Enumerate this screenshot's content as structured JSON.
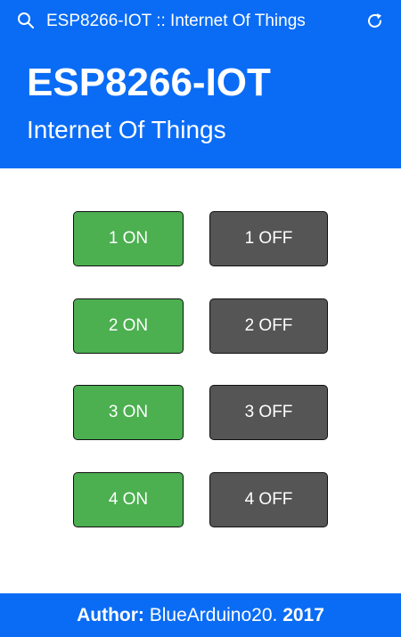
{
  "topbar": {
    "title": "ESP8266-IOT :: Internet Of Things",
    "icons": [
      "search-icon",
      "reload-icon"
    ]
  },
  "hero": {
    "title": "ESP8266-IOT",
    "subtitle": "Internet Of Things"
  },
  "controls": [
    {
      "on_label": "1 ON",
      "off_label": "1 OFF"
    },
    {
      "on_label": "2 ON",
      "off_label": "2 OFF"
    },
    {
      "on_label": "3 ON",
      "off_label": "3 OFF"
    },
    {
      "on_label": "4 ON",
      "off_label": "4 OFF"
    }
  ],
  "footer": {
    "author_label": "Author:",
    "author_name": " BlueArduino20. ",
    "year": "2017"
  },
  "colors": {
    "accent": "#0a6cf5",
    "on": "#4caf50",
    "off": "#555555"
  }
}
